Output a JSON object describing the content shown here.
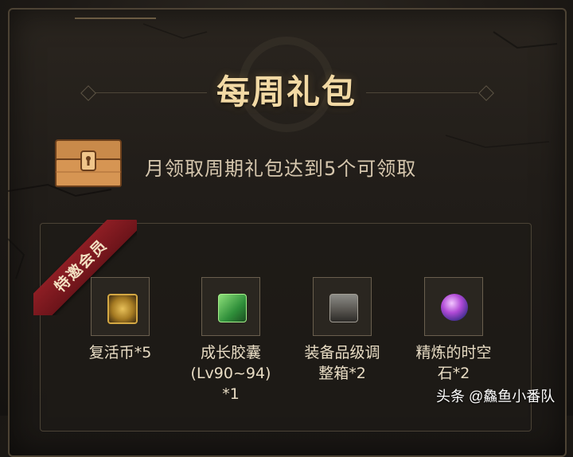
{
  "header": {
    "title": "每周礼包"
  },
  "reward_info": {
    "description": "月领取周期礼包达到5个可领取"
  },
  "ribbon": {
    "label": "特邀会员"
  },
  "items": [
    {
      "label": "复活币*5",
      "icon": "revival-coin-icon"
    },
    {
      "label": "成长胶囊\n(Lv90~94)\n*1",
      "icon": "growth-capsule-icon"
    },
    {
      "label": "装备品级调\n整箱*2",
      "icon": "equipment-grade-box-icon"
    },
    {
      "label": "精炼的时空\n石*2",
      "icon": "refined-time-stone-icon"
    }
  ],
  "watermark": {
    "text": "头条 @鱻鱼小番队"
  },
  "colors": {
    "title": "#f2d9a4",
    "ribbon": "#8e1e24",
    "text": "#e8dcc4"
  }
}
